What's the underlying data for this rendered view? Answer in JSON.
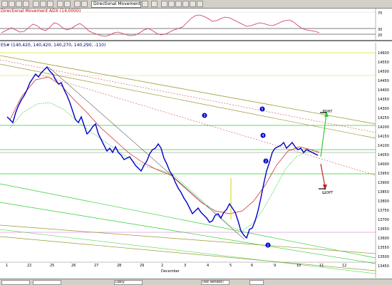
{
  "toolbar": {
    "indicator": "Directional Movement ADX"
  },
  "top_pane": {
    "title": "Directional Movement ADX (14,0000)",
    "title_color": "#cc0000",
    "axis_labels": [
      "70",
      "30",
      "20"
    ]
  },
  "main_pane": {
    "title": "ES# (140,420, 140,420, 140,270, 140,290, -110)",
    "title_color": "#000080",
    "price_labels": [
      "14600",
      "14550",
      "14500",
      "14450",
      "14400",
      "14350",
      "14300",
      "14250",
      "14200",
      "14150",
      "14100",
      "14050",
      "14000",
      "13950",
      "13900",
      "13850",
      "13800",
      "13750",
      "13700",
      "13650",
      "13600",
      "13550",
      "13500",
      "13450"
    ],
    "date_labels": [
      "1",
      "22",
      "25",
      "26",
      "27",
      "28",
      "29",
      "2",
      "3",
      "4",
      "5",
      "6",
      "9",
      "10",
      "11",
      "12"
    ],
    "month_label": "December",
    "markers": [
      "1",
      "2",
      "3",
      "4",
      "5"
    ],
    "long_label": "ЛОНГ",
    "short_label": "ШОРТ"
  },
  "statusbar": {
    "vendor": "(No Vendor)",
    "field_3": "Daily"
  },
  "colors": {
    "window_bg": "#d4d0c8",
    "candles": "#0000cc",
    "marker_fill": "#0000cc",
    "green_line": "#33cc33",
    "olive_line": "#999933",
    "red_line": "#cc2222",
    "long_arrow": "#33cc33",
    "short_arrow": "#cc2222",
    "yellow_line": "#dddd33"
  }
}
